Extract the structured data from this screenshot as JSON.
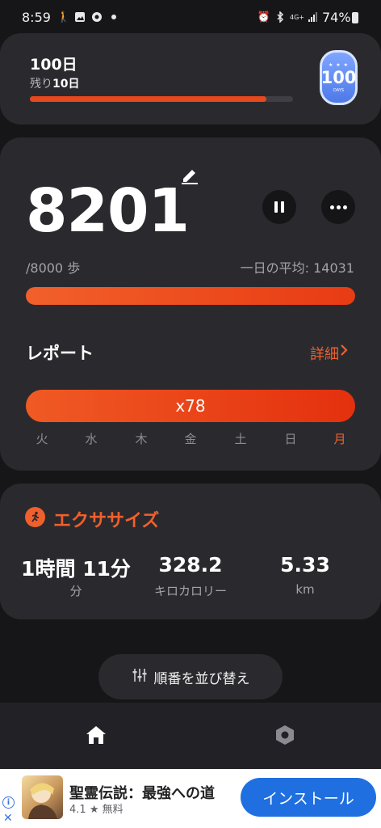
{
  "status_bar": {
    "time": "8:59",
    "network": "4G+",
    "battery": "74%"
  },
  "challenge": {
    "title": "100日",
    "remaining_prefix": "残り",
    "remaining_value": "10日",
    "progress_fraction": 0.9,
    "badge": {
      "stars": "★ ★ ★",
      "number": "100",
      "label": "DAYS"
    }
  },
  "steps": {
    "count": "8201",
    "goal": "/8000 歩",
    "daily_average": "一日の平均: 14031",
    "progress_fraction": 1.0
  },
  "report": {
    "title": "レポート",
    "detail_label": "詳細",
    "bar_label": "x78",
    "days": [
      "火",
      "水",
      "木",
      "金",
      "土",
      "日",
      "月"
    ],
    "active_day": "月"
  },
  "exercise": {
    "title": "エクササイズ",
    "stats": [
      {
        "value": "1時間 11分",
        "unit": "分"
      },
      {
        "value": "328.2",
        "unit": "キロカロリー"
      },
      {
        "value": "5.33",
        "unit": "km"
      }
    ]
  },
  "reorder": {
    "label": "順番を並び替え"
  },
  "ad": {
    "title": "聖霊伝説：最強への道",
    "rating": "4.1",
    "price": "無料",
    "install_label": "インストール"
  },
  "colors": {
    "accent": "#f0602c",
    "card": "#2a2a2e",
    "background": "#161619"
  }
}
